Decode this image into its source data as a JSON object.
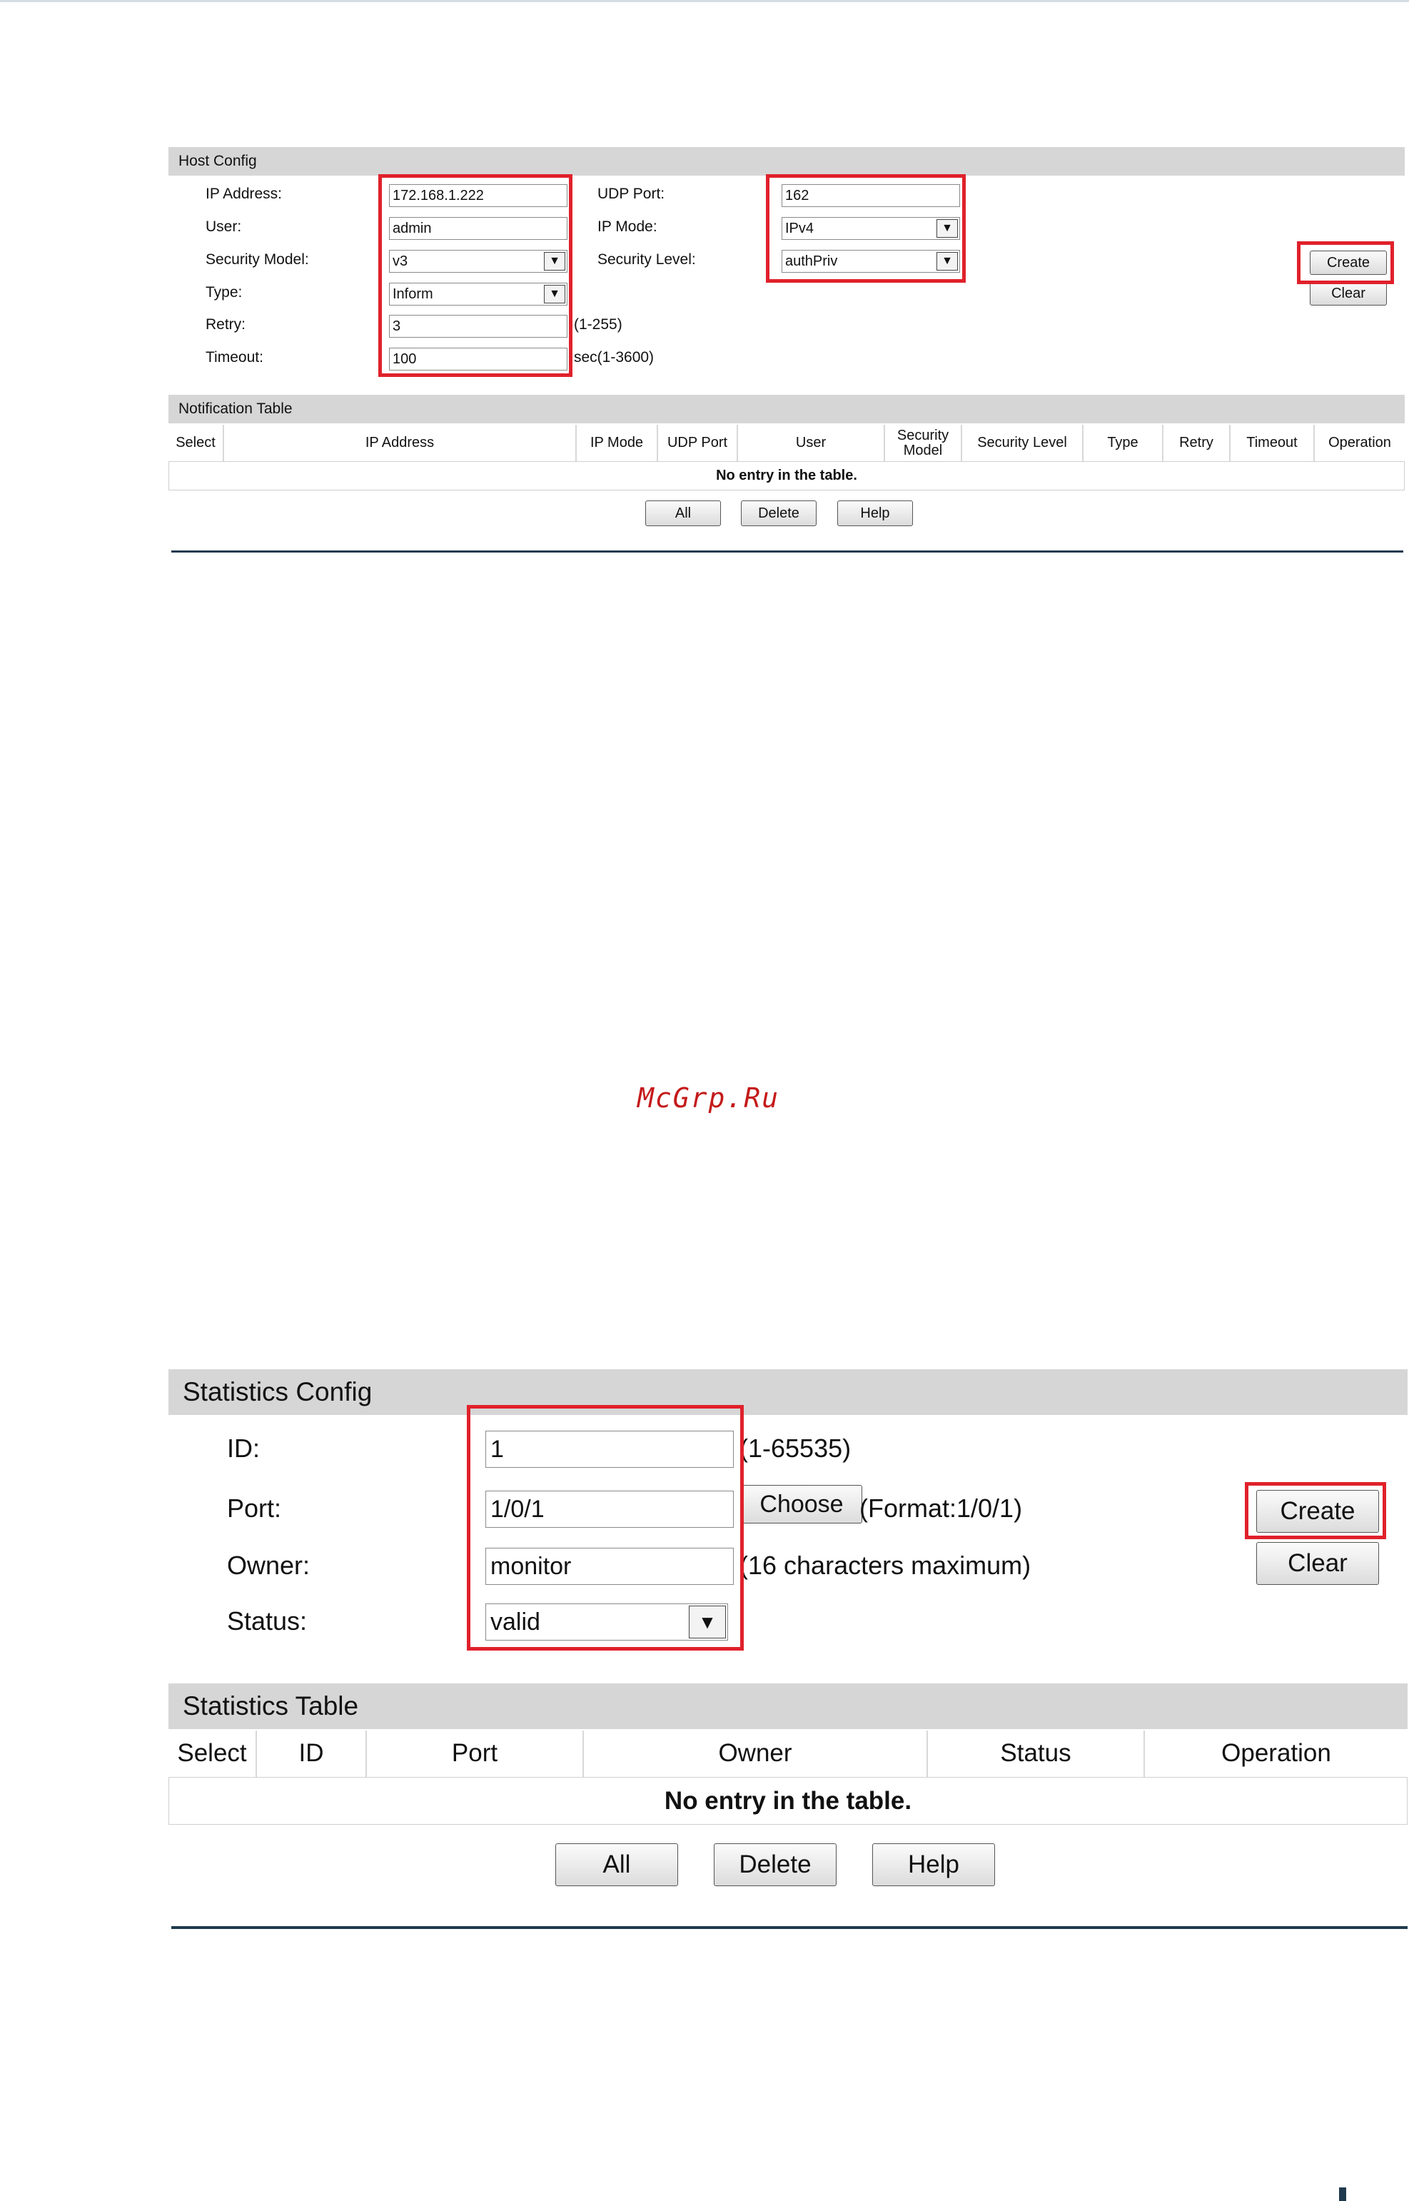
{
  "host_config": {
    "title": "Host Config",
    "fields": {
      "ip_address": {
        "label": "IP Address:",
        "value": "172.168.1.222"
      },
      "user": {
        "label": "User:",
        "value": "admin"
      },
      "security_model": {
        "label": "Security Model:",
        "value": "v3"
      },
      "type": {
        "label": "Type:",
        "value": "Inform"
      },
      "retry": {
        "label": "Retry:",
        "value": "3",
        "hint": "(1-255)"
      },
      "timeout": {
        "label": "Timeout:",
        "value": "100",
        "hint": "sec(1-3600)"
      },
      "udp_port": {
        "label": "UDP Port:",
        "value": "162"
      },
      "ip_mode": {
        "label": "IP Mode:",
        "value": "IPv4"
      },
      "security_level": {
        "label": "Security Level:",
        "value": "authPriv"
      }
    },
    "buttons": {
      "create": "Create",
      "clear": "Clear"
    }
  },
  "notification_table": {
    "title": "Notification Table",
    "columns": [
      "Select",
      "IP Address",
      "IP Mode",
      "UDP Port",
      "User",
      "Security Model",
      "Security Level",
      "Type",
      "Retry",
      "Timeout",
      "Operation"
    ],
    "empty_text": "No entry in the table.",
    "buttons": {
      "all": "All",
      "delete": "Delete",
      "help": "Help"
    }
  },
  "watermark": "McGrp.Ru",
  "statistics_config": {
    "title": "Statistics Config",
    "fields": {
      "id": {
        "label": "ID:",
        "value": "1",
        "hint": "(1-65535)"
      },
      "port": {
        "label": "Port:",
        "value": "1/0/1",
        "choose_label": "Choose",
        "hint": "(Format:1/0/1)"
      },
      "owner": {
        "label": "Owner:",
        "value": "monitor",
        "hint": "(16 characters maximum)"
      },
      "status": {
        "label": "Status:",
        "value": "valid"
      }
    },
    "buttons": {
      "create": "Create",
      "clear": "Clear"
    }
  },
  "statistics_table": {
    "title": "Statistics Table",
    "columns": [
      "Select",
      "ID",
      "Port",
      "Owner",
      "Status",
      "Operation"
    ],
    "empty_text": "No entry in the table.",
    "buttons": {
      "all": "All",
      "delete": "Delete",
      "help": "Help"
    }
  },
  "colors": {
    "highlight": "#e0212b",
    "header_bg": "#d6d6d6",
    "divider": "#1f3a4d",
    "watermark": "#c41a1a"
  },
  "icons": {
    "select_arrow": "chevron-down-icon",
    "page_mark": "square-bullet-icon"
  }
}
